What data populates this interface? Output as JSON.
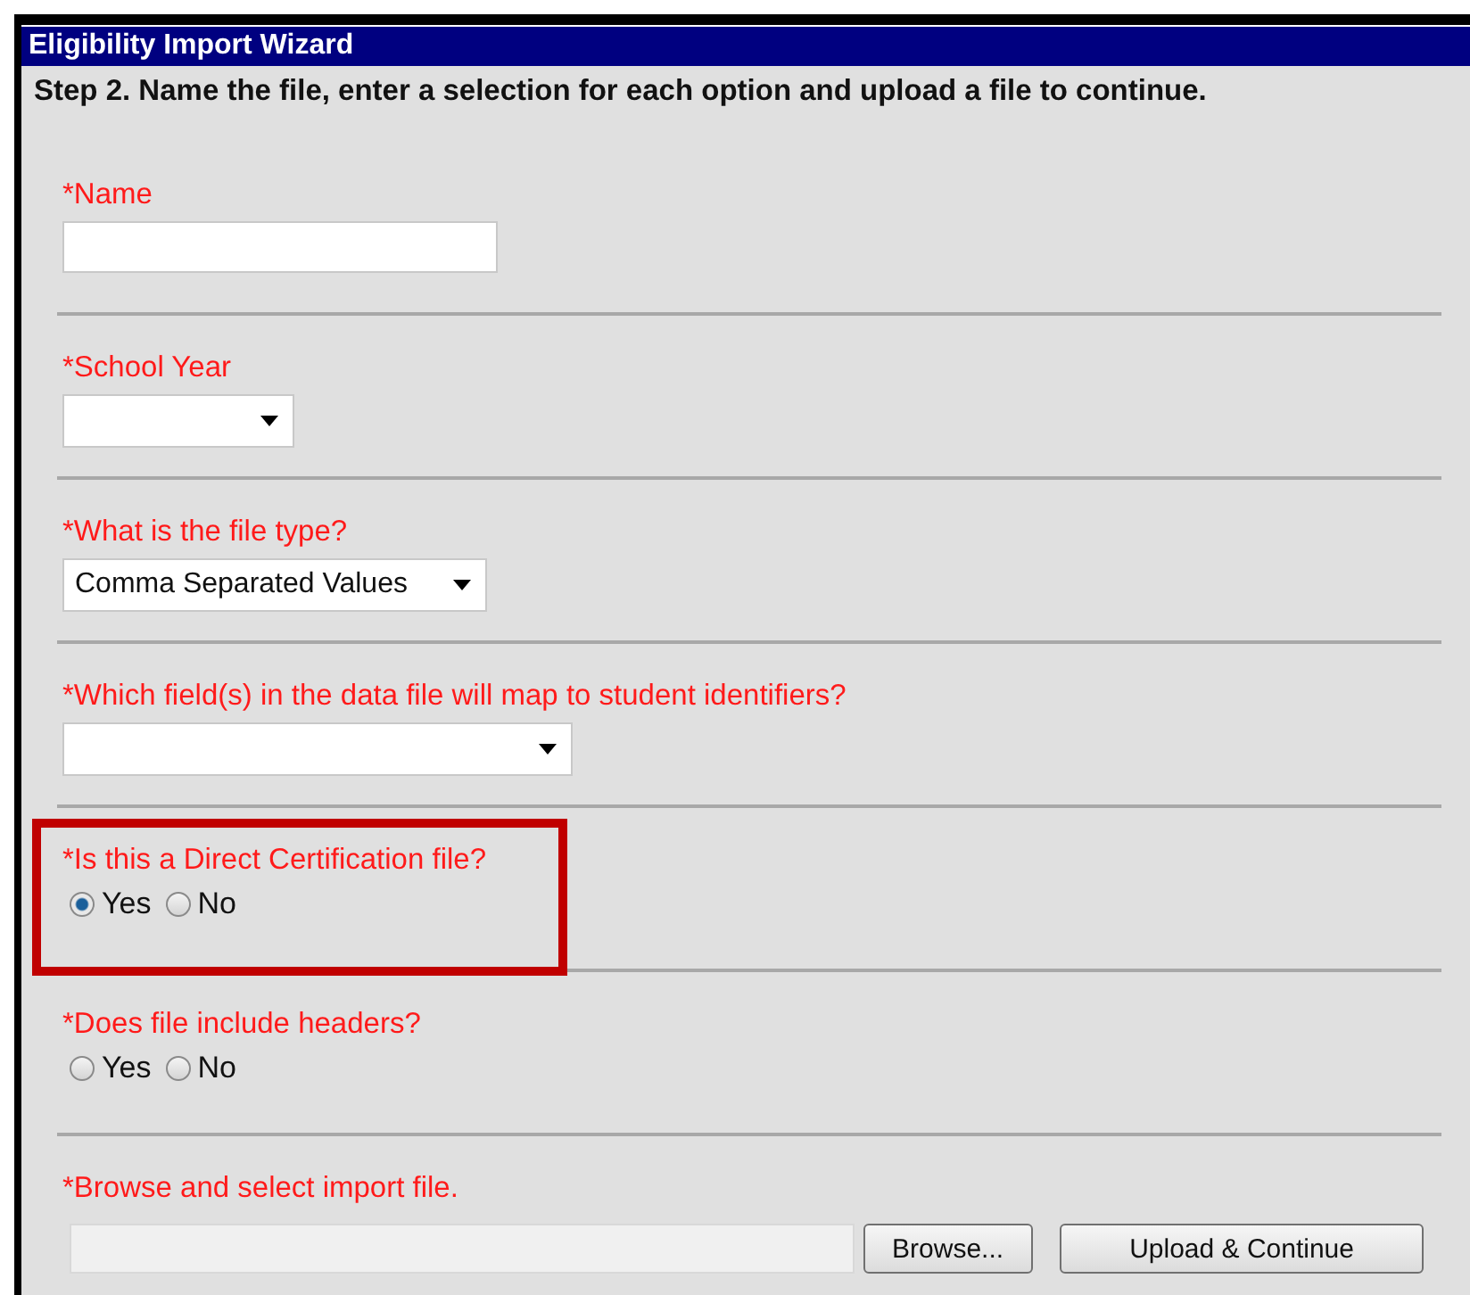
{
  "window": {
    "title": "Eligibility Import Wizard"
  },
  "instructions": "Step 2. Name the file, enter a selection for each option and upload a file to continue.",
  "fields": [
    {
      "kind": "text",
      "label": "*Name",
      "highlighted": false
    },
    {
      "kind": "select",
      "label": "*School Year",
      "highlighted": false
    },
    {
      "kind": "select",
      "label": "*What is the file type?",
      "value": "Comma Separated Values",
      "highlighted": false
    },
    {
      "kind": "select",
      "label": "*Which field(s) in the data file will map to student identifiers?",
      "highlighted": false
    },
    {
      "kind": "radio",
      "label": "*Is this a Direct Certification file?",
      "highlighted": true,
      "options": [
        {
          "label": "Yes",
          "selected": true
        },
        {
          "label": "No",
          "selected": false
        }
      ]
    },
    {
      "kind": "radio",
      "label": "*Does file include headers?",
      "highlighted": false,
      "options": [
        {
          "label": "Yes",
          "selected": false
        },
        {
          "label": "No",
          "selected": false
        }
      ]
    },
    {
      "kind": "file",
      "label": "*Browse and select import file.",
      "highlighted": false,
      "buttons": [
        "Browse...",
        "Upload & Continue"
      ]
    }
  ]
}
